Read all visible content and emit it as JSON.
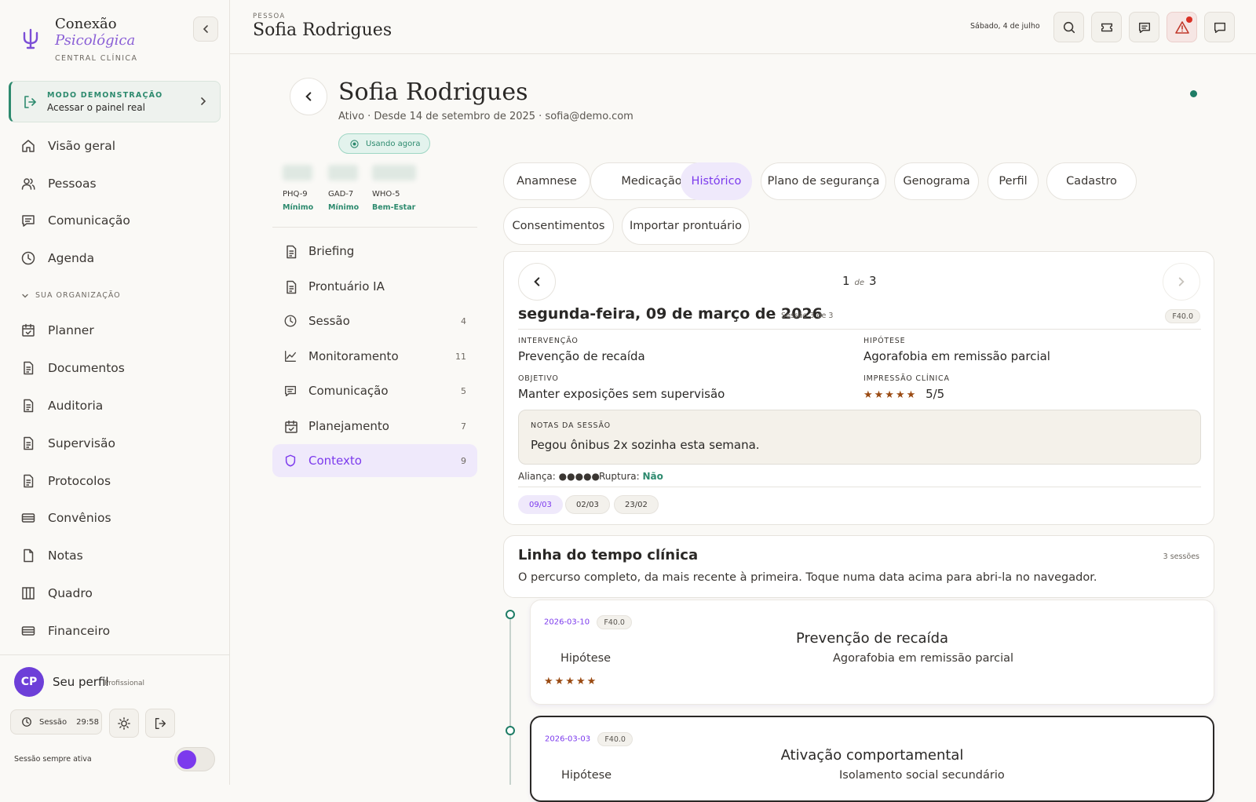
{
  "sidebar": {
    "brand": {
      "name": "Conexão",
      "sub": "Psicológica",
      "tag": "CENTRAL CLÍNICA"
    },
    "demo": {
      "label": "MODO DEMONSTRAÇÃO",
      "title": "Acessar o painel real"
    },
    "items": [
      {
        "label": "Visão geral",
        "icon": "home-icon"
      },
      {
        "label": "Pessoas",
        "icon": "users-icon"
      },
      {
        "label": "Comunicação",
        "icon": "message-icon"
      },
      {
        "label": "Agenda",
        "icon": "clock-icon"
      }
    ],
    "org_header": "SUA ORGANIZAÇÃO",
    "org_items": [
      {
        "label": "Planner",
        "icon": "calendar-check-icon"
      },
      {
        "label": "Documentos",
        "icon": "document-icon"
      },
      {
        "label": "Auditoria",
        "icon": "document-icon"
      },
      {
        "label": "Supervisão",
        "icon": "document-icon"
      },
      {
        "label": "Protocolos",
        "icon": "document-icon"
      },
      {
        "label": "Convênios",
        "icon": "card-icon"
      },
      {
        "label": "Notas",
        "icon": "file-icon"
      },
      {
        "label": "Quadro",
        "icon": "columns-icon"
      },
      {
        "label": "Financeiro",
        "icon": "card-icon"
      }
    ],
    "profile": {
      "initials": "CP",
      "name": "Seu perfil",
      "role": "Profissional"
    },
    "session": {
      "label": "Sessão",
      "time": "29:58"
    },
    "always_active": "Sessão sempre ativa",
    "always_active_on": true
  },
  "header": {
    "crumb": "PESSOA",
    "title": "Sofia Rodrigues",
    "date": "Sábado, 4 de julho"
  },
  "patient": {
    "name": "Sofia Rodrigues",
    "meta": "Ativo · Desde 14 de setembro de 2025 · sofia@demo.com",
    "status": "Usando agora",
    "scores": [
      {
        "name": "PHQ-9",
        "level": "Mínimo"
      },
      {
        "name": "GAD-7",
        "level": "Mínimo"
      },
      {
        "name": "WHO-5",
        "level": "Bem-Estar"
      }
    ]
  },
  "side_menu": [
    {
      "label": "Briefing",
      "count": "",
      "icon": "document-icon"
    },
    {
      "label": "Prontuário IA",
      "count": "",
      "icon": "document-icon"
    },
    {
      "label": "Sessão",
      "count": "4",
      "icon": "clock-icon"
    },
    {
      "label": "Monitoramento",
      "count": "11",
      "icon": "chart-icon"
    },
    {
      "label": "Comunicação",
      "count": "5",
      "icon": "message-icon"
    },
    {
      "label": "Planejamento",
      "count": "7",
      "icon": "calendar-check-icon"
    },
    {
      "label": "Contexto",
      "count": "9",
      "icon": "shield-icon"
    }
  ],
  "tabs": [
    "Anamnese",
    "Medicação",
    "Histórico",
    "Plano de segurança",
    "Genograma",
    "Perfil",
    "Cadastro",
    "Consentimentos",
    "Importar prontuário"
  ],
  "active_tab": "Histórico",
  "session_card": {
    "page": "1",
    "of": "de",
    "total": "3",
    "date": "segunda-feira, 09 de março de 2026",
    "session_of": "Sessão 3 de 3",
    "code": "F40.0",
    "intervention_label": "INTERVENÇÃO",
    "intervention": "Prevenção de recaída",
    "hypothesis_label": "HIPÓTESE",
    "hypothesis": "Agorafobia em remissão parcial",
    "objective_label": "OBJETIVO",
    "objective": "Manter exposições sem supervisão",
    "impression_label": "IMPRESSÃO CLÍNICA",
    "impression_stars": "★★★★★",
    "impression": "5/5",
    "notes_label": "NOTAS DA SESSÃO",
    "notes": "Pegou ônibus 2x sozinha esta semana.",
    "alliance_label": "Aliança:",
    "alliance_dots": "●●●●●",
    "rupture_label": "Ruptura:",
    "rupture": "Não",
    "dates": [
      "09/03",
      "02/03",
      "23/02"
    ]
  },
  "timeline": {
    "title": "Linha do tempo clínica",
    "subtitle": "O percurso completo, da mais recente à primeira. Toque numa data acima para abri-la no navegador.",
    "count": "3 sessões",
    "entries": [
      {
        "date": "2026-03-10",
        "code": "F40.0",
        "title": "Prevenção de recaída",
        "hyp_label": "Hipótese",
        "hyp": "Agorafobia em remissão parcial",
        "stars": "★★★★★"
      },
      {
        "date": "2026-03-03",
        "code": "F40.0",
        "title": "Ativação comportamental",
        "hyp_label": "Hipótese",
        "hyp": "Isolamento social secundário",
        "stars": ""
      }
    ]
  },
  "colors": {
    "accent": "#7c3aed",
    "green": "#2d8a6e",
    "alert": "#d93025",
    "star": "#9a4a12"
  }
}
